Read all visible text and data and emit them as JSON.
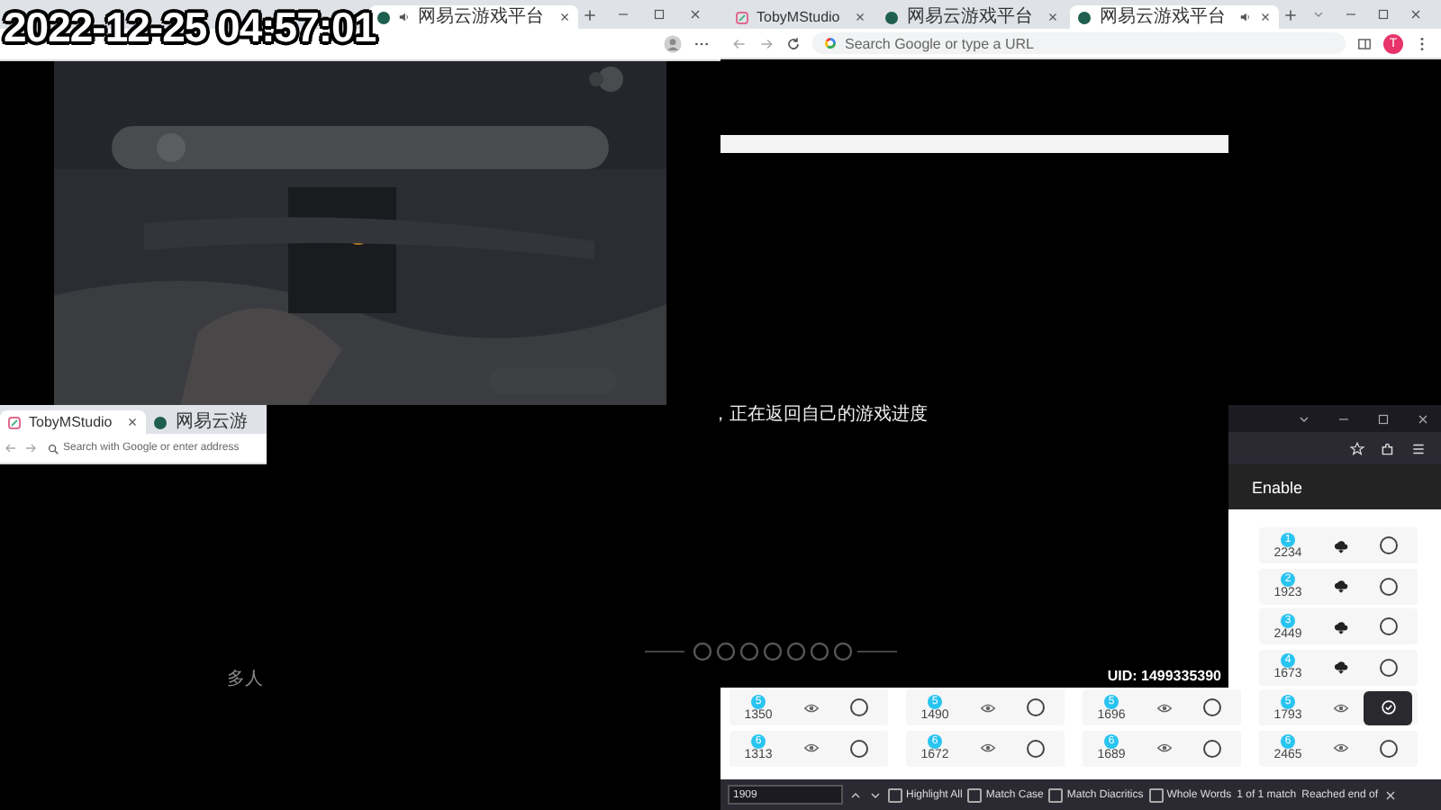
{
  "timestamp": "2022-12-25 04:57:01",
  "top_left_window": {
    "tabs": [
      {
        "title": "网易云游戏平台",
        "kind": "game",
        "selected": true,
        "audio": true
      }
    ]
  },
  "top_right_window": {
    "tabs": [
      {
        "title": "TobyMStudio",
        "kind": "studio",
        "selected": false,
        "audio": false
      },
      {
        "title": "网易云游戏平台",
        "kind": "game",
        "selected": false,
        "audio": false
      },
      {
        "title": "网易云游戏平台",
        "kind": "game",
        "selected": true,
        "audio": true
      }
    ],
    "address_placeholder": "Search Google or type a URL",
    "avatar_letter": "T"
  },
  "bottom_left_window": {
    "tabs": [
      {
        "title": "TobyMStudio",
        "kind": "studio",
        "selected": true
      },
      {
        "title": "网易云游",
        "kind": "game",
        "selected": false
      }
    ],
    "address_placeholder": "Search with Google or enter address",
    "caption": "多人"
  },
  "center_window": {
    "caption": "，正在返回自己的游戏进度",
    "uid": "UID: 1499335390"
  },
  "bottom_right_window": {
    "header_label": "Enable",
    "grid": {
      "rows": [
        {
          "cells": [
            {
              "badge": "1",
              "value": "2234",
              "kind": "cloud",
              "selected": false
            }
          ]
        },
        {
          "cells": [
            {
              "badge": "2",
              "value": "1923",
              "kind": "cloud",
              "selected": false
            }
          ]
        },
        {
          "cells": [
            {
              "badge": "3",
              "value": "2449",
              "kind": "cloud",
              "selected": false
            }
          ]
        },
        {
          "cells": [
            {
              "badge": "4",
              "value": "1673",
              "kind": "cloud",
              "selected": false
            }
          ]
        },
        {
          "cells": [
            {
              "badge": "5",
              "value": "1350",
              "kind": "eye",
              "selected": false
            },
            {
              "badge": "5",
              "value": "1490",
              "kind": "eye",
              "selected": false
            },
            {
              "badge": "5",
              "value": "1696",
              "kind": "eye",
              "selected": false
            },
            {
              "badge": "5",
              "value": "1793",
              "kind": "eye",
              "selected": true
            }
          ]
        },
        {
          "cells": [
            {
              "badge": "6",
              "value": "1313",
              "kind": "eye",
              "selected": false
            },
            {
              "badge": "6",
              "value": "1672",
              "kind": "eye",
              "selected": false
            },
            {
              "badge": "6",
              "value": "1689",
              "kind": "eye",
              "selected": false
            },
            {
              "badge": "6",
              "value": "2465",
              "kind": "eye",
              "selected": false
            }
          ]
        }
      ]
    },
    "find_bar": {
      "query": "1909",
      "options": [
        {
          "label": "Highlight All",
          "checked": false
        },
        {
          "label": "Match Case",
          "checked": false
        },
        {
          "label": "Match Diacritics",
          "checked": false
        },
        {
          "label": "Whole Words",
          "checked": false
        }
      ],
      "status": "1 of 1 match",
      "notice": "Reached end of"
    }
  }
}
